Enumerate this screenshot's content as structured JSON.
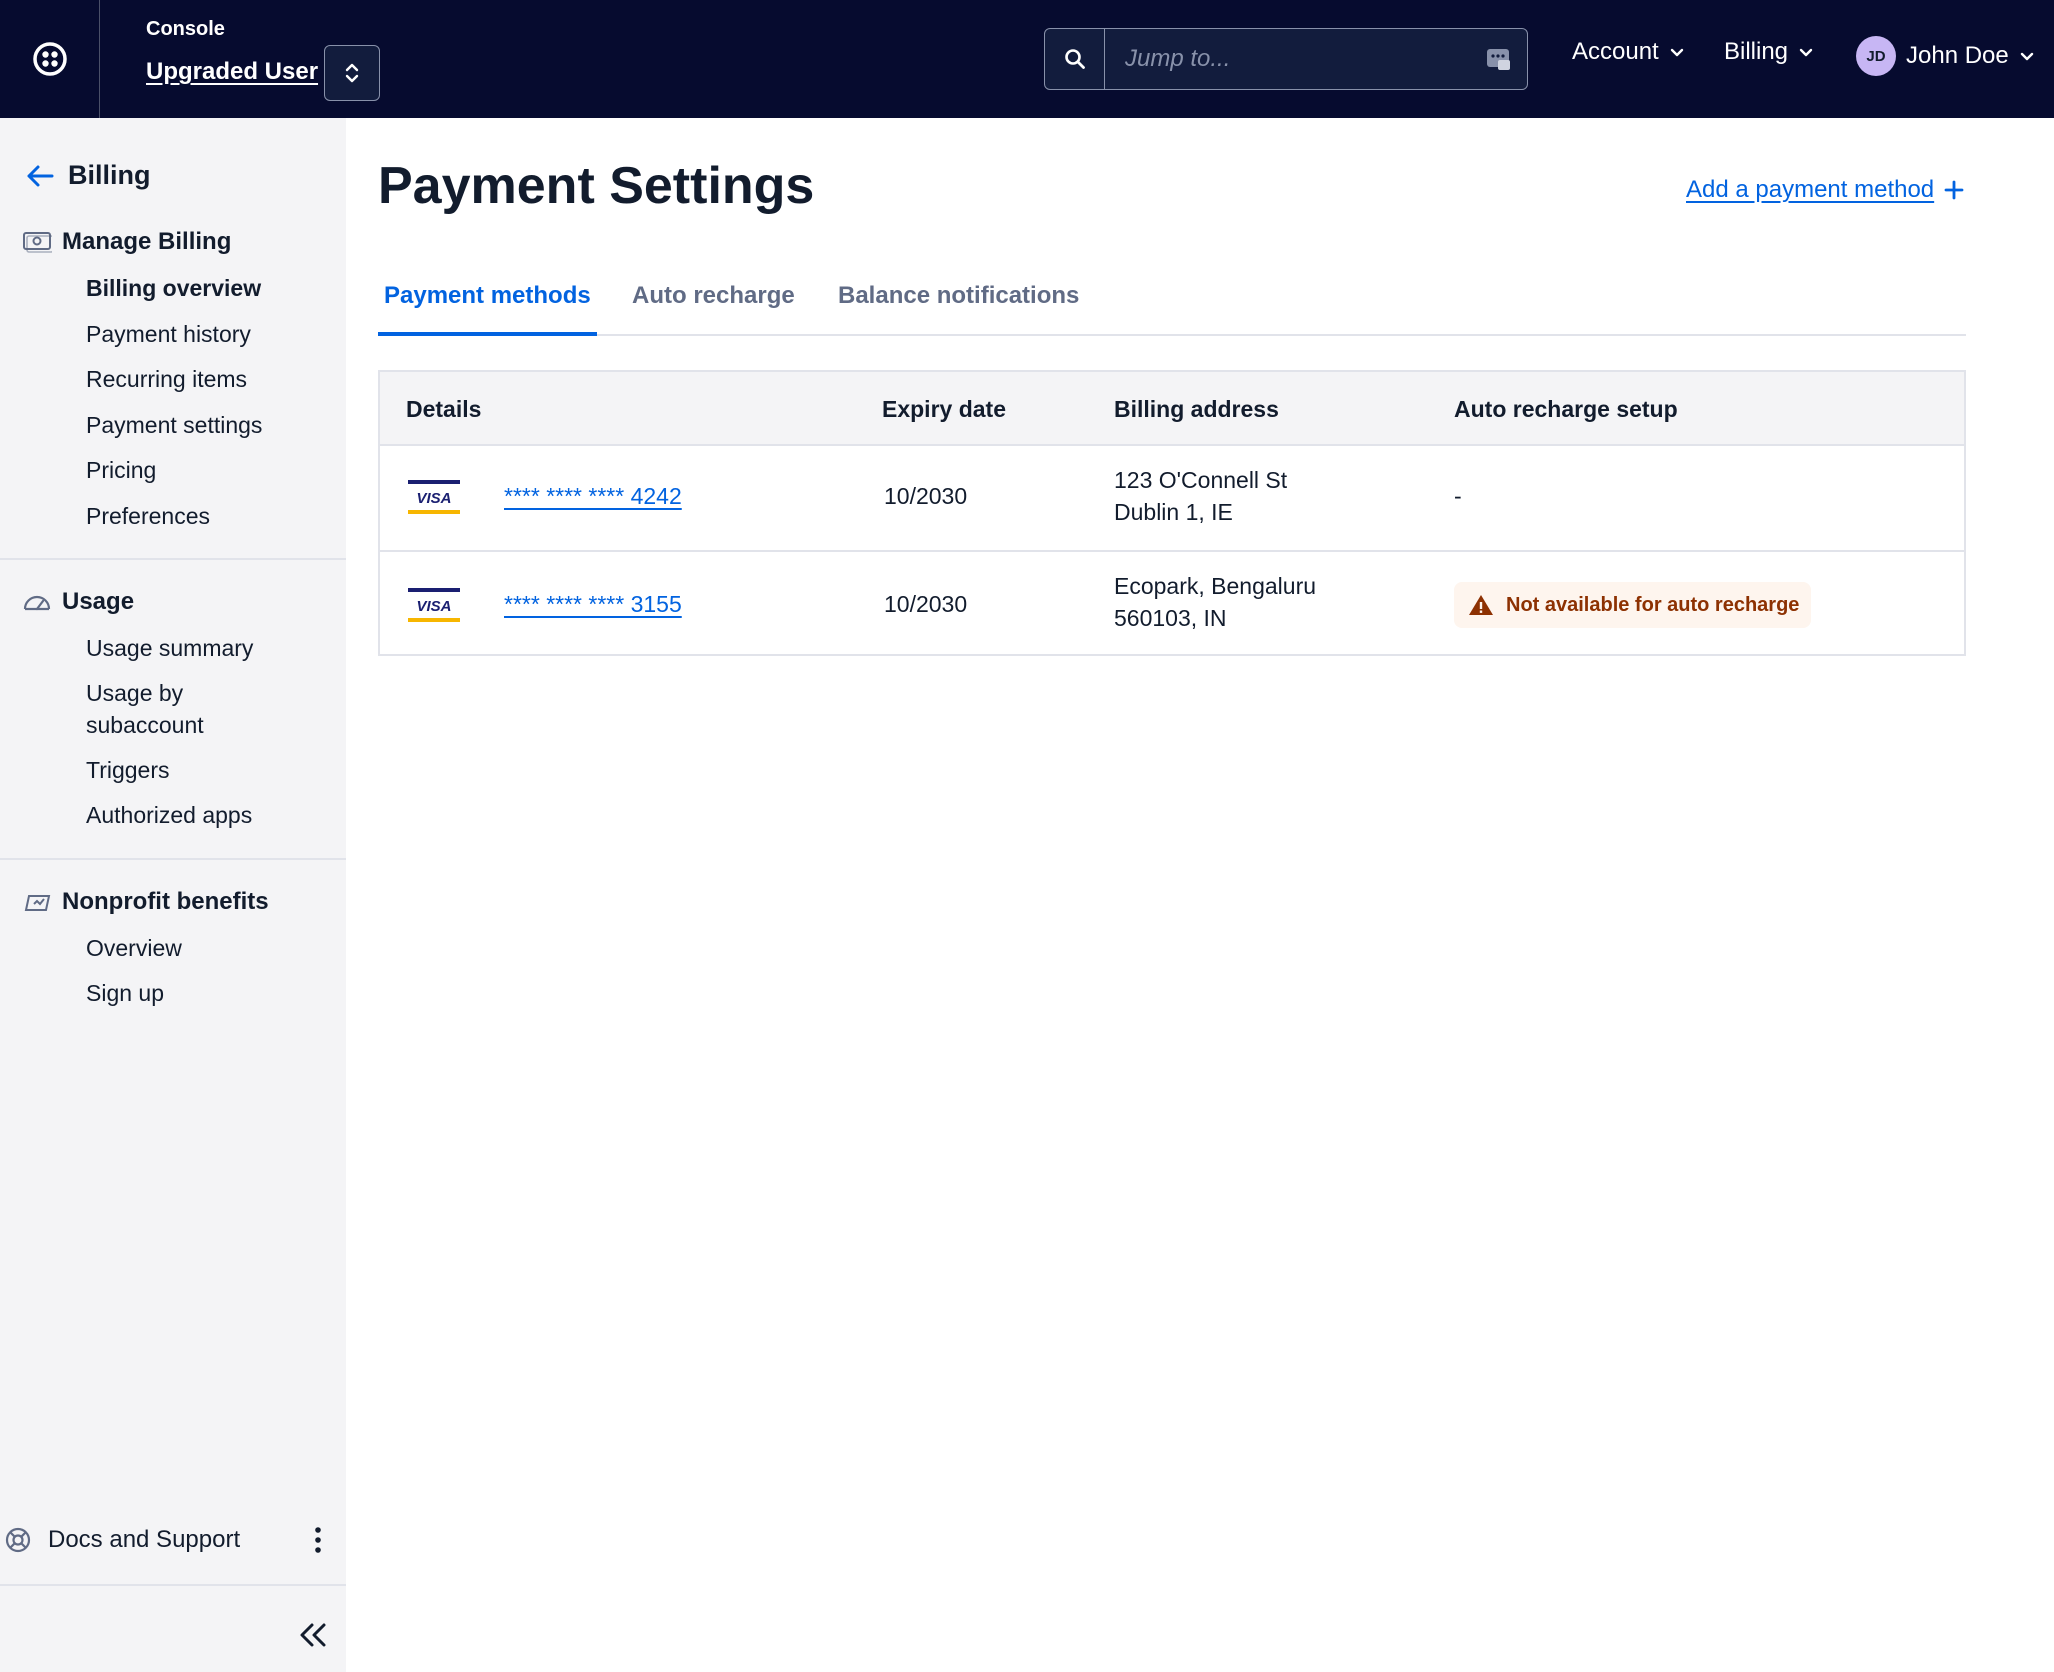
{
  "topbar": {
    "console_label": "Console",
    "account_name": "Upgraded User",
    "search_placeholder": "Jump to...",
    "menus": [
      {
        "label": "Account"
      },
      {
        "label": "Billing"
      }
    ],
    "user": {
      "initials": "JD",
      "name": "John Doe"
    }
  },
  "sidebar": {
    "back_title": "Billing",
    "sections": [
      {
        "title": "Manage Billing",
        "icon": "billing-icon",
        "items": [
          "Billing overview",
          "Payment history",
          "Recurring items",
          "Payment settings",
          "Pricing",
          "Preferences"
        ],
        "active_item": "Billing overview"
      },
      {
        "title": "Usage",
        "icon": "gauge-icon",
        "items": [
          "Usage summary",
          "Usage by subaccount",
          "Triggers",
          "Authorized apps"
        ]
      },
      {
        "title": "Nonprofit benefits",
        "icon": "nonprofit-icon",
        "items": [
          "Overview",
          "Sign up"
        ]
      }
    ],
    "docs_label": "Docs and Support"
  },
  "main": {
    "title": "Payment Settings",
    "add_link": "Add a payment method",
    "tabs": [
      {
        "label": "Payment methods",
        "active": true
      },
      {
        "label": "Auto recharge",
        "active": false
      },
      {
        "label": "Balance notifications",
        "active": false
      }
    ],
    "table": {
      "columns": [
        "Details",
        "Expiry date",
        "Billing address",
        "Auto recharge setup"
      ],
      "rows": [
        {
          "card_brand": "VISA",
          "card_number": "**** **** **** 4242",
          "expiry": "10/2030",
          "address_line1": "123 O'Connell St",
          "address_line2": "Dublin 1, IE",
          "auto_recharge": "-"
        },
        {
          "card_brand": "VISA",
          "card_number": "**** **** **** 3155",
          "expiry": "10/2030",
          "address_line1": "Ecopark, Bengaluru",
          "address_line2": "560103, IN",
          "auto_recharge": "Not available for auto recharge"
        }
      ]
    }
  },
  "colors": {
    "topbar_bg": "#060b2f",
    "link_blue": "#0263e0",
    "sidebar_bg": "#f4f4f6",
    "warning_text": "#8d3102",
    "warning_bg": "#fef5ee"
  }
}
